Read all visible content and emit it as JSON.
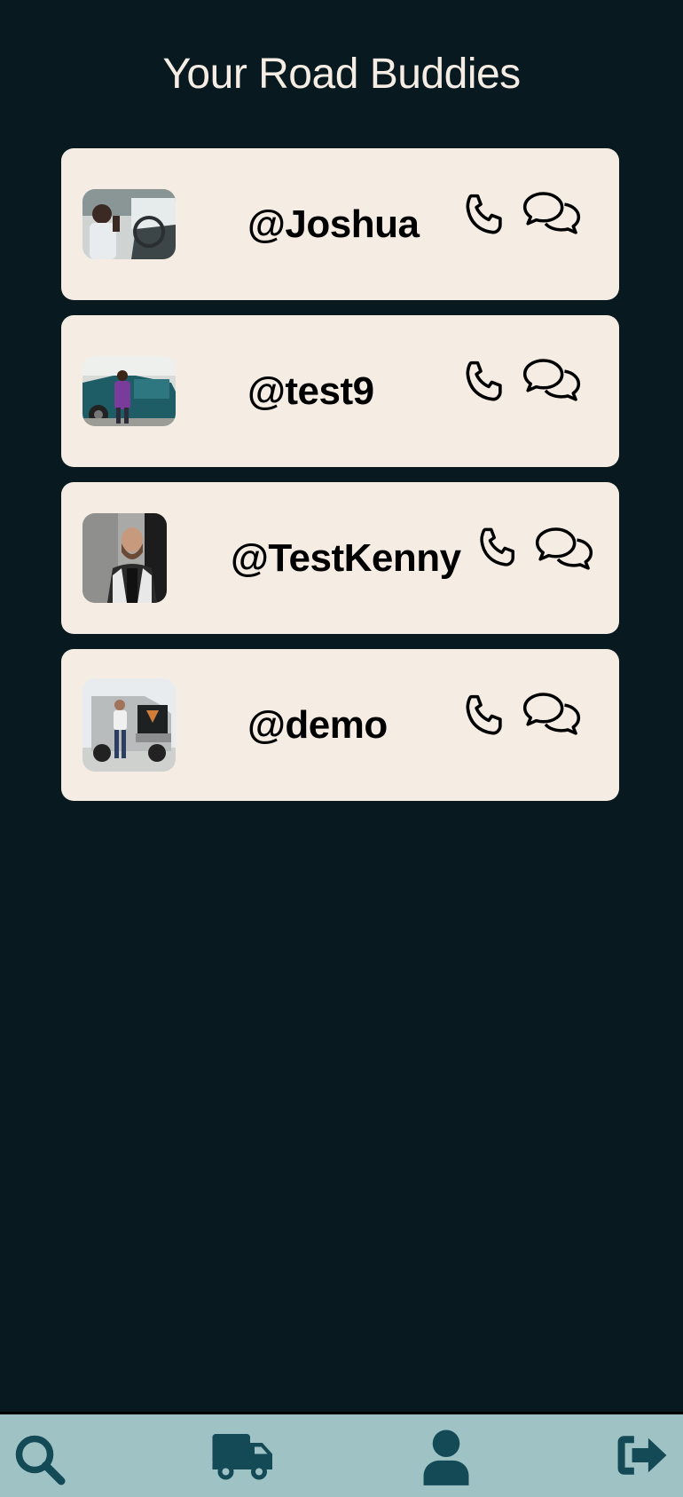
{
  "header": {
    "title": "Your Road Buddies"
  },
  "buddies": [
    {
      "username": "@Joshua",
      "avatar": "driver-in-cab-photo"
    },
    {
      "username": "@test9",
      "avatar": "driver-by-truck-photo"
    },
    {
      "username": "@TestKenny",
      "avatar": "bearded-man-photo"
    },
    {
      "username": "@demo",
      "avatar": "driver-with-truck-photo"
    }
  ],
  "icons": {
    "call": "phone-icon",
    "chat": "chat-bubbles-icon"
  },
  "nav": {
    "items": [
      {
        "name": "search",
        "icon": "search-icon"
      },
      {
        "name": "trucks",
        "icon": "truck-icon"
      },
      {
        "name": "profile",
        "icon": "user-icon"
      },
      {
        "name": "logout",
        "icon": "logout-icon"
      }
    ]
  },
  "colors": {
    "background": "#081a20",
    "card": "#f5ede4",
    "nav": "#9fc3c5",
    "nav_icon": "#134a56"
  }
}
